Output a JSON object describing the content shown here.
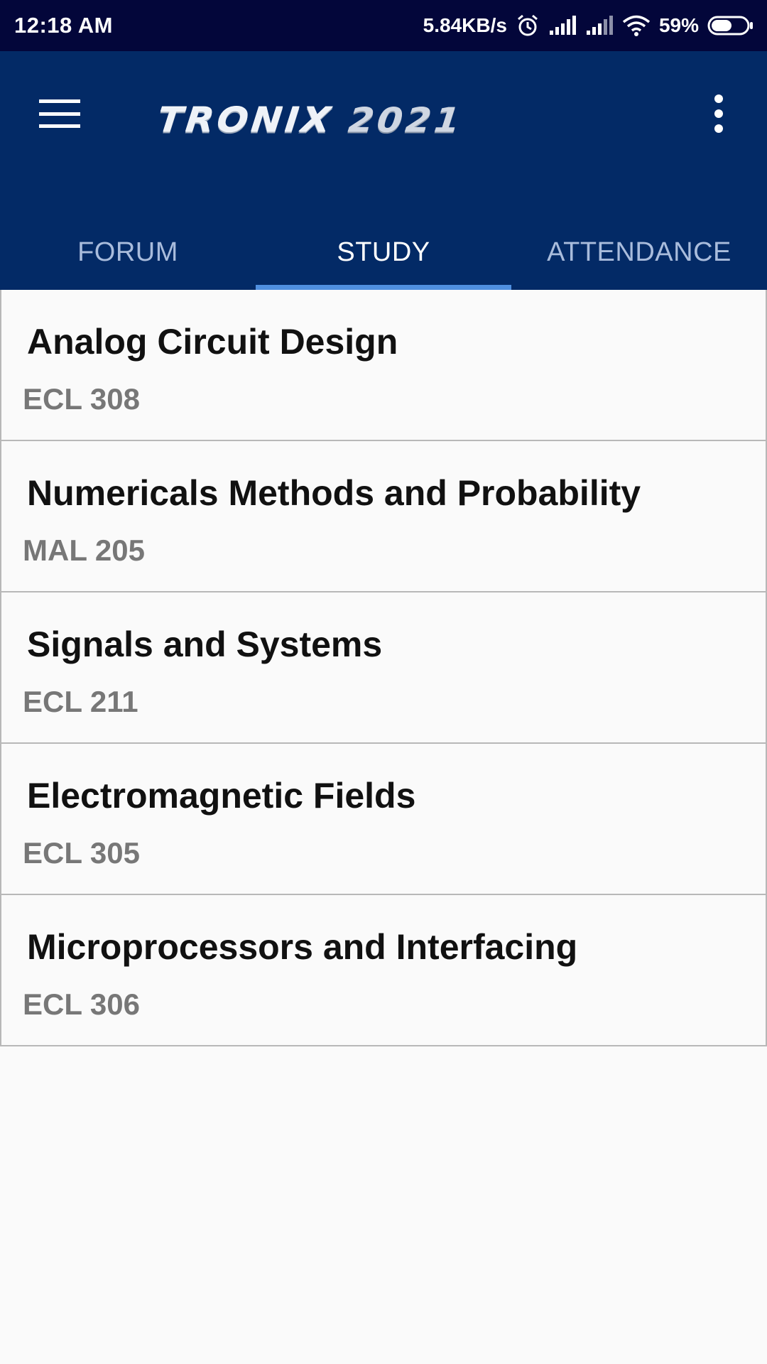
{
  "status_bar": {
    "time": "12:18 AM",
    "network_speed": "5.84KB/s",
    "battery_percent": "59%",
    "battery_level": 0.59,
    "icons": [
      "alarm-icon",
      "signal-icon",
      "signal-icon",
      "wifi-icon",
      "battery-icon"
    ]
  },
  "app_bar": {
    "logo_text_a": "TRONIX",
    "logo_text_b": "2021",
    "menu_icon": "hamburger-menu-icon",
    "overflow_icon": "more-vert-icon",
    "background_color": "#032a66"
  },
  "tabs": [
    {
      "label": "FORUM",
      "active": false
    },
    {
      "label": "STUDY",
      "active": true
    },
    {
      "label": "ATTENDANCE",
      "active": false
    }
  ],
  "courses": [
    {
      "name": "Analog Circuit Design",
      "code": "ECL 308"
    },
    {
      "name": "Numericals Methods and Probability",
      "code": "MAL 205"
    },
    {
      "name": "Signals and Systems",
      "code": "ECL 211"
    },
    {
      "name": "Electromagnetic Fields",
      "code": "ECL 305"
    },
    {
      "name": "Microprocessors and Interfacing",
      "code": "ECL 306"
    }
  ]
}
